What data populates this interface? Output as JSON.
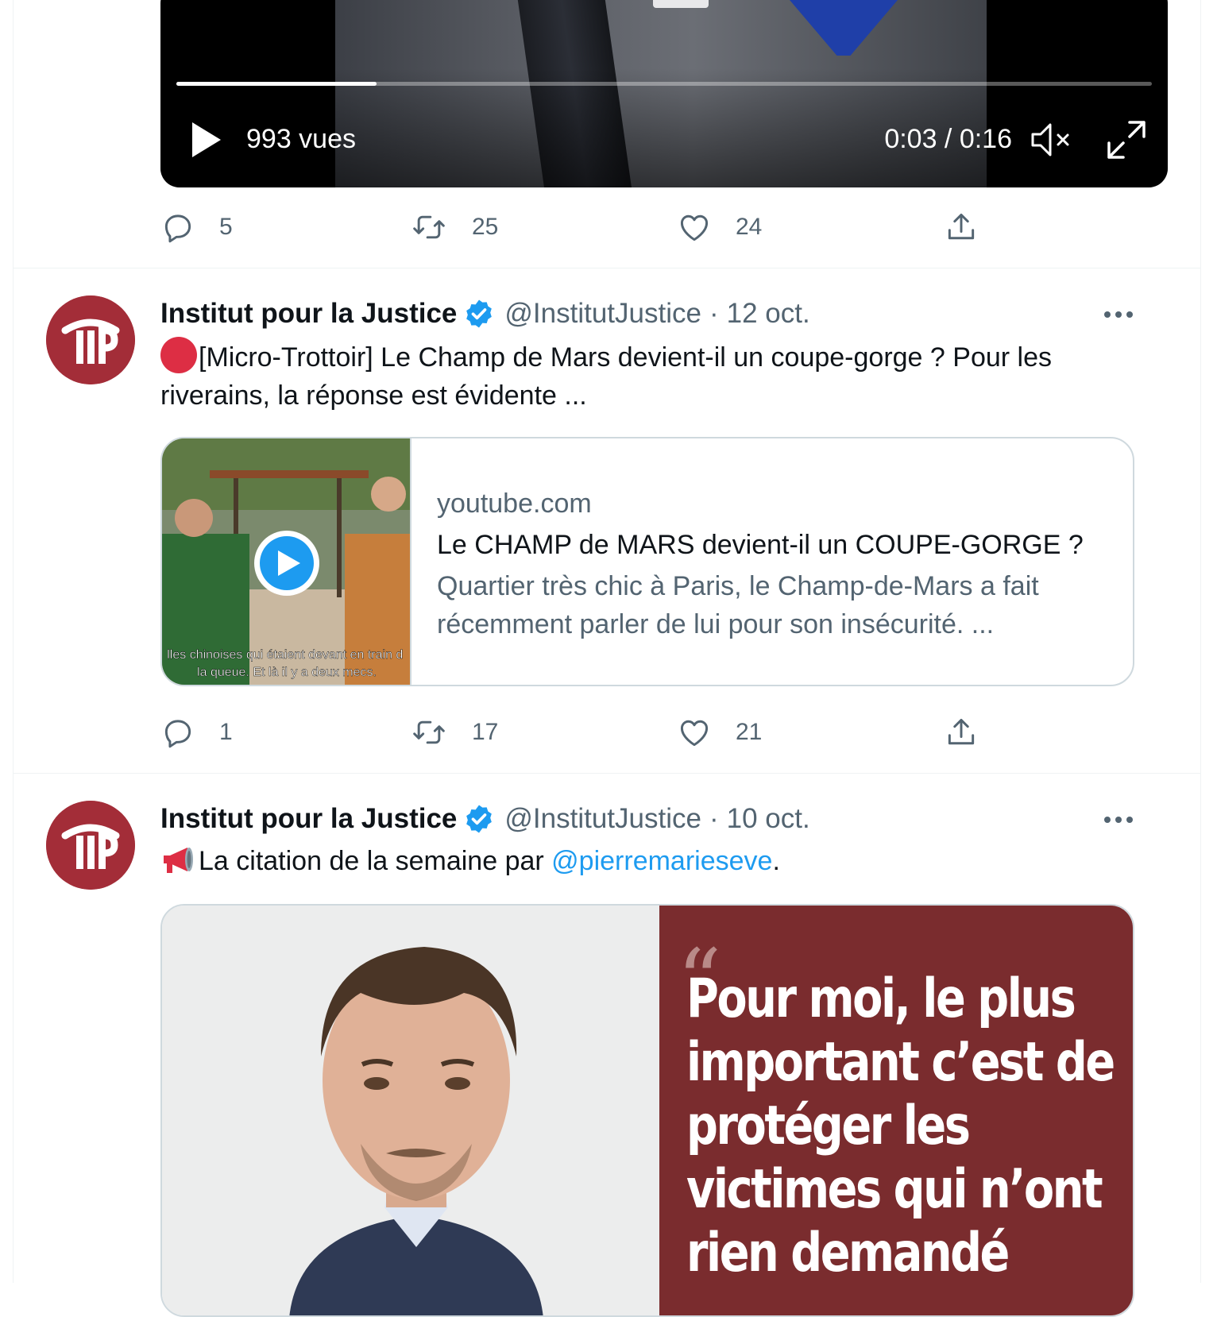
{
  "video": {
    "views": "993 vues",
    "time": "0:03 / 0:16",
    "progress_fraction": 0.205
  },
  "tweets": [
    {
      "actions": {
        "replies": "5",
        "retweets": "25",
        "likes": "24"
      }
    },
    {
      "author_name": "Institut pour la Justice",
      "handle": "@InstitutJustice",
      "separator": "·",
      "date": "12 oct.",
      "text": "[Micro-Trottoir] Le Champ de Mars devient-il un coupe-gorge ? Pour les riverains, la réponse est évidente ...",
      "card": {
        "thumbnail_caption": "lles chinoises qui étaient devant en train d la queue. Et là il y a deux mecs.",
        "domain": "youtube.com",
        "title": "Le CHAMP de MARS devient-il un COUPE-GORGE ?",
        "description": "Quartier très chic à Paris, le Champ-de-Mars a fait récemment parler de lui pour son insécurité. ..."
      },
      "actions": {
        "replies": "1",
        "retweets": "17",
        "likes": "21"
      }
    },
    {
      "author_name": "Institut pour la Justice",
      "handle": "@InstitutJustice",
      "separator": "·",
      "date": "10 oct.",
      "text_before": "La citation de la semaine par ",
      "mention": "@pierremarieseve",
      "text_after": ".",
      "quote_image_text": "Pour moi, le plus important c’est de protéger les victimes qui n’ont rien demandé"
    }
  ],
  "icons": {
    "reply": "reply-icon",
    "retweet": "retweet-icon",
    "like": "heart-icon",
    "share": "share-icon",
    "verified": "verified-badge-icon",
    "more": "more-options-icon",
    "megaphone": "megaphone-icon"
  },
  "colors": {
    "accent": "#1d9bf0",
    "secondary_text": "#536471",
    "brand_red": "#a32d38",
    "quote_bg": "#7a2c2e",
    "border": "#cfd9de"
  }
}
